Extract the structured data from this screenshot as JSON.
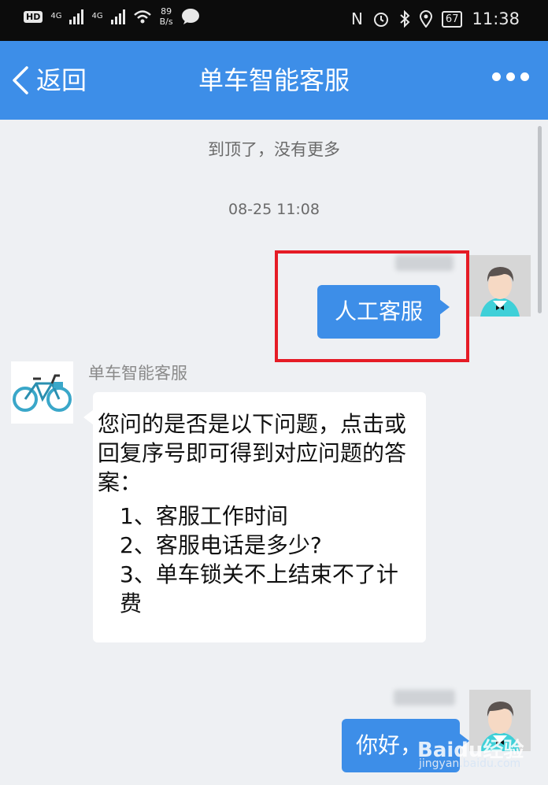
{
  "status_bar": {
    "hd": "HD",
    "net1": "4G",
    "net2": "4G",
    "speed_value": "89",
    "speed_unit": "B/s",
    "nfc": "N",
    "battery": "67",
    "time": "11:38"
  },
  "header": {
    "back_label": "返回",
    "title": "单车智能客服"
  },
  "chat": {
    "top_notice": "到顶了，没有更多",
    "timestamp": "08-25 11:08",
    "user_message_1": "人工客服",
    "bot_name": "单车智能客服",
    "bot_message": {
      "intro": "您问的是否是以下问题，点击或回复序号即可得到对应问题的答案：",
      "options": [
        "1、客服工作时间",
        "2、客服电话是多少?",
        "3、单车锁关不上结束不了计费"
      ]
    },
    "user_message_2": "你好，",
    "watermark": "Baidu经验",
    "watermark_sub": "jingyan.baidu.com"
  },
  "colors": {
    "accent": "#3d8ee8",
    "highlight": "#e51b25",
    "background": "#eef0f3"
  }
}
